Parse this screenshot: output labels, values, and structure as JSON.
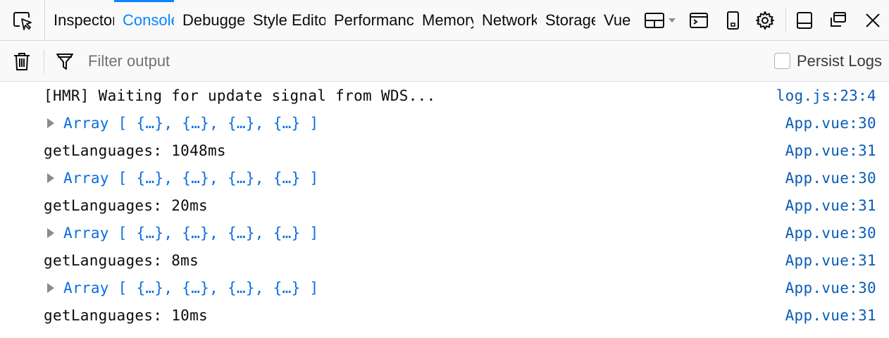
{
  "toolbar": {
    "tabs": [
      {
        "id": "inspector",
        "label": "Inspector",
        "selected": false
      },
      {
        "id": "console",
        "label": "Console",
        "selected": true
      },
      {
        "id": "debugger",
        "label": "Debugger",
        "selected": false
      },
      {
        "id": "style",
        "label": "Style Editor",
        "selected": false
      },
      {
        "id": "perf",
        "label": "Performance",
        "selected": false
      },
      {
        "id": "memory",
        "label": "Memory",
        "selected": false
      },
      {
        "id": "network",
        "label": "Network",
        "selected": false
      },
      {
        "id": "storage",
        "label": "Storage",
        "selected": false
      },
      {
        "id": "vue",
        "label": "Vue",
        "selected": false
      }
    ],
    "icons": [
      "element-picker-icon",
      "dock-layout-icon",
      "split-console-icon",
      "responsive-design-icon",
      "gear-icon",
      "dock-bottom-icon",
      "separate-window-icon",
      "close-icon"
    ]
  },
  "filterbar": {
    "placeholder": "Filter output",
    "value": "",
    "persist_label": "Persist Logs",
    "persist_checked": false
  },
  "messages": [
    {
      "type": "log",
      "text": "[HMR] Waiting for update signal from WDS...",
      "location": "log.js:23:4"
    },
    {
      "type": "array",
      "text": "Array [ {…}, {…}, {…}, {…} ]",
      "location": "App.vue:30"
    },
    {
      "type": "log",
      "text": "getLanguages: 1048ms",
      "location": "App.vue:31"
    },
    {
      "type": "array",
      "text": "Array [ {…}, {…}, {…}, {…} ]",
      "location": "App.vue:30"
    },
    {
      "type": "log",
      "text": "getLanguages: 20ms",
      "location": "App.vue:31"
    },
    {
      "type": "array",
      "text": "Array [ {…}, {…}, {…}, {…} ]",
      "location": "App.vue:30"
    },
    {
      "type": "log",
      "text": "getLanguages: 8ms",
      "location": "App.vue:31"
    },
    {
      "type": "array",
      "text": "Array [ {…}, {…}, {…}, {…} ]",
      "location": "App.vue:30"
    },
    {
      "type": "log",
      "text": "getLanguages: 10ms",
      "location": "App.vue:31"
    }
  ],
  "colors": {
    "accent": "#0a84ff",
    "array_text": "#0a6ee0",
    "location_link": "#0a5cb5"
  }
}
